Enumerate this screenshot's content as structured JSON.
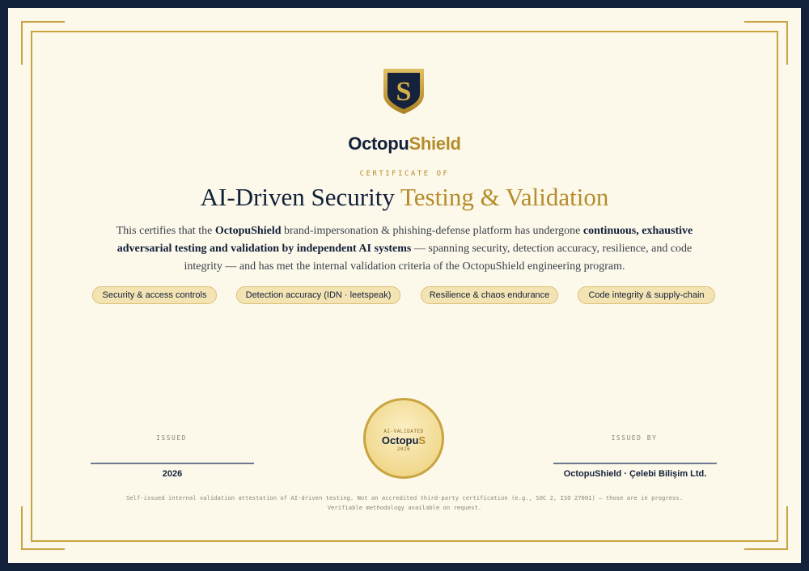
{
  "brand": {
    "name_part1": "Octopu",
    "name_part2": "Shield",
    "logo_letter": "S"
  },
  "certificate": {
    "kicker": "CERTIFICATE OF",
    "title_part1": "AI-Driven Security ",
    "title_part2": "Testing & Validation",
    "body": {
      "t1": "This certifies that the ",
      "b1": "OctopuShield",
      "t2": " brand-impersonation & phishing-defense platform has undergone ",
      "b2": "continuous, exhaustive adversarial testing and validation by independent AI systems",
      "t3": " — spanning security, detection accuracy, resilience, and code integrity — and has met the internal validation criteria of the OctopuShield engineering program."
    }
  },
  "pills": [
    "Security & access controls",
    "Detection accuracy (IDN · leetspeak)",
    "Resilience & chaos endurance",
    "Code integrity & supply-chain"
  ],
  "issued": {
    "label": "ISSUED",
    "value": "2026"
  },
  "issued_by": {
    "label": "ISSUED BY",
    "value": "OctopuShield · Çelebi Bilişim Ltd."
  },
  "seal": {
    "top": "AI-VALIDATED",
    "name_part1": "Octopu",
    "name_part2": "S",
    "year": "2026"
  },
  "footnote": {
    "line1": "Self-issued internal validation attestation of AI-driven testing. Not an accredited third-party certification (e.g., SOC 2, ISO 27001) — those are in progress.",
    "line2": "Verifiable methodology available on request."
  },
  "colors": {
    "navy": "#12203a",
    "gold": "#b58c2a",
    "paper": "#fcf8ea",
    "frame": "#c9a441"
  }
}
